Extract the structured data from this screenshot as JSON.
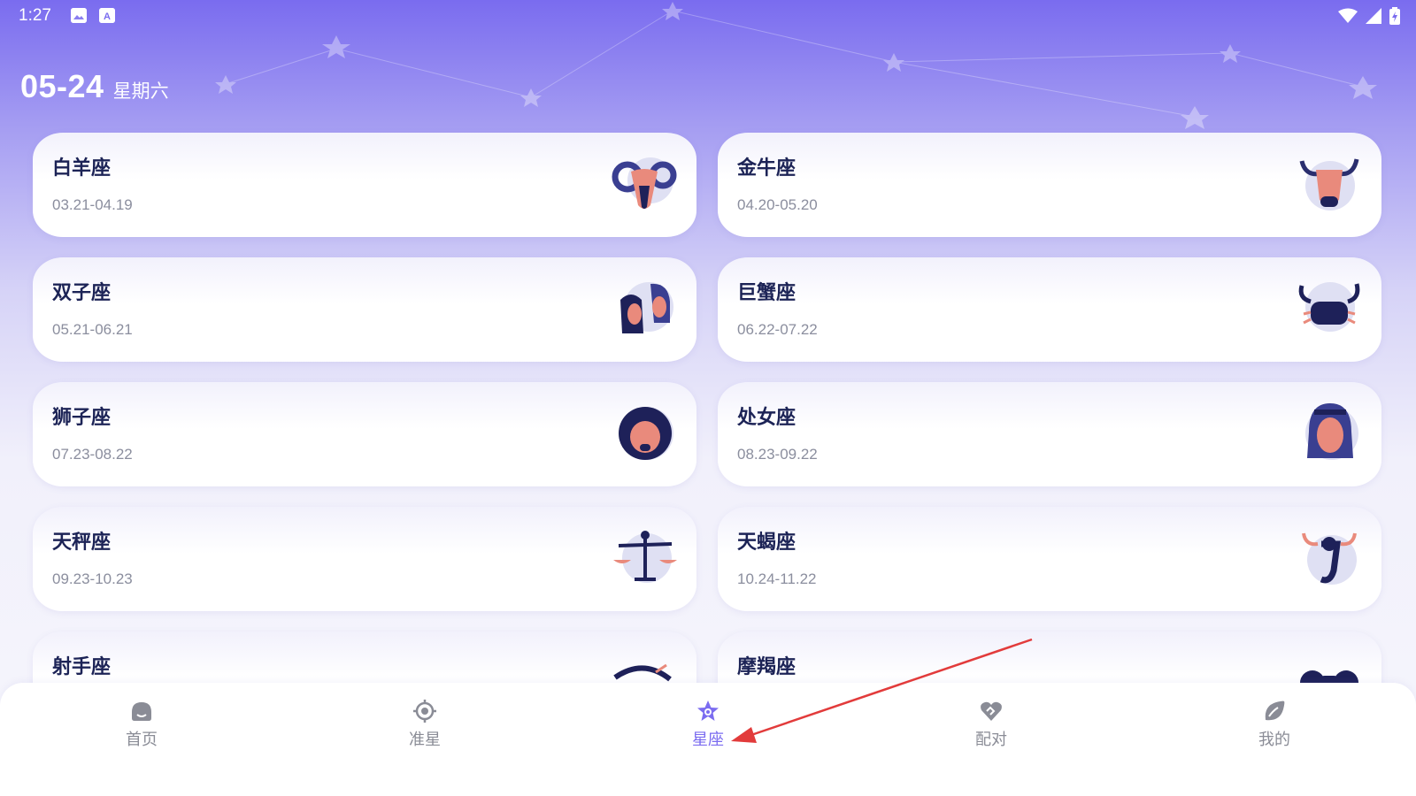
{
  "status_bar": {
    "time": "1:27",
    "left_icons": [
      "image-icon",
      "a-icon"
    ],
    "right_icons": [
      "wifi-icon",
      "signal-icon",
      "battery-charging-icon"
    ]
  },
  "header": {
    "date": "05-24",
    "weekday": "星期六"
  },
  "zodiacs": [
    {
      "name": "白羊座",
      "range": "03.21-04.19",
      "icon": "aries-ram-icon"
    },
    {
      "name": "金牛座",
      "range": "04.20-05.20",
      "icon": "taurus-bull-icon"
    },
    {
      "name": "双子座",
      "range": "05.21-06.21",
      "icon": "gemini-twins-icon"
    },
    {
      "name": "巨蟹座",
      "range": "06.22-07.22",
      "icon": "cancer-crab-icon"
    },
    {
      "name": "狮子座",
      "range": "07.23-08.22",
      "icon": "leo-lion-icon"
    },
    {
      "name": "处女座",
      "range": "08.23-09.22",
      "icon": "virgo-maiden-icon"
    },
    {
      "name": "天秤座",
      "range": "09.23-10.23",
      "icon": "libra-scales-icon"
    },
    {
      "name": "天蝎座",
      "range": "10.24-11.22",
      "icon": "scorpio-scorpion-icon"
    },
    {
      "name": "射手座",
      "range": "",
      "icon": "sagittarius-bow-icon"
    },
    {
      "name": "摩羯座",
      "range": "",
      "icon": "capricorn-goat-icon"
    }
  ],
  "nav": {
    "items": [
      {
        "label": "首页",
        "icon": "home-icon"
      },
      {
        "label": "准星",
        "icon": "crosshair-icon"
      },
      {
        "label": "星座",
        "icon": "constellation-star-icon"
      },
      {
        "label": "配对",
        "icon": "pair-heart-icon"
      },
      {
        "label": "我的",
        "icon": "profile-leaf-icon"
      }
    ],
    "active": "星座"
  },
  "colors": {
    "accent": "#7b6cf0",
    "header_top": "#7a6cef",
    "title_text": "#1c2356",
    "sub_text": "#8b8e9e",
    "annotation_arrow": "#e23b3b"
  }
}
